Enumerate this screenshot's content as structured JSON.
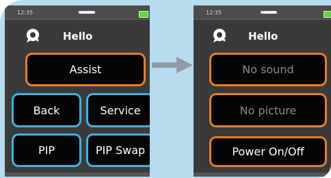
{
  "left_screen": {
    "status": {
      "time": "12:35"
    },
    "header": {
      "title": "Hello",
      "icon": "assistant-logo-icon"
    },
    "buttons": {
      "assist": "Assist",
      "back": "Back",
      "service": "Service",
      "pip": "PIP",
      "pip_swap": "PIP Swap"
    }
  },
  "right_screen": {
    "status": {
      "time": "12:35"
    },
    "header": {
      "title": "Hello",
      "icon": "assistant-logo-icon"
    },
    "buttons": {
      "no_sound": "No sound",
      "no_picture": "No picture",
      "power": "Power On/Off"
    }
  },
  "transition": {
    "icon": "arrow-right-icon"
  },
  "colors": {
    "background_panel": "#b8dcef",
    "orange_accent": "#ef7d1e",
    "blue_accent": "#3bb4e8",
    "screen_bg": "#3a3a3a",
    "battery": "#55dd33"
  }
}
